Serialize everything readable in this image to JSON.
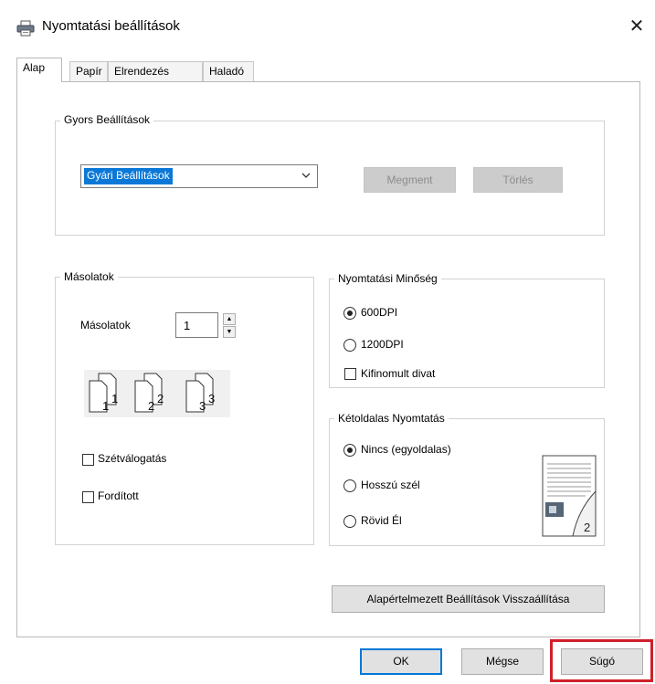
{
  "window": {
    "title": "Nyomtatási beállítások",
    "close_symbol": "✕"
  },
  "tabs": [
    {
      "label": "Alap",
      "active": true
    },
    {
      "label": "Papír",
      "active": false
    },
    {
      "label": "Elrendezés",
      "active": false
    },
    {
      "label": "Haladó",
      "active": false
    }
  ],
  "quick_settings": {
    "title": "Gyors Beállítások",
    "selected": "Gyári Beállítások",
    "save_label": "Megment",
    "delete_label": "Törlés"
  },
  "copies": {
    "group_title": "Másolatok",
    "label": "Másolatok",
    "value": "1",
    "collate_label": "Szétválogatás",
    "collate_checked": false,
    "reverse_label": "Fordított",
    "reverse_checked": false,
    "page_icon_numbers": [
      "1",
      "1",
      "2",
      "2",
      "3",
      "3"
    ]
  },
  "quality": {
    "group_title": "Nyomtatási Minőség",
    "options": [
      {
        "label": "600DPI",
        "selected": true
      },
      {
        "label": "1200DPI",
        "selected": false
      }
    ],
    "refined_label": "Kifinomult divat",
    "refined_checked": false
  },
  "duplex": {
    "group_title": "Kétoldalas Nyomtatás",
    "options": [
      {
        "label": "Nincs (egyoldalas)",
        "selected": true
      },
      {
        "label": "Hosszú szél",
        "selected": false
      },
      {
        "label": "Rövid Él",
        "selected": false
      }
    ],
    "preview_page_number": "2"
  },
  "restore_defaults_label": "Alapértelmezett Beállítások Visszaállítása",
  "footer": {
    "ok_label": "OK",
    "cancel_label": "Mégse",
    "help_label": "Súgó"
  },
  "colors": {
    "selection": "#0b78d7",
    "highlight_frame": "#d0202a",
    "default_button_border": "#0078d7"
  },
  "icons": [
    "printer-icon",
    "close-icon",
    "chevron-down-icon",
    "spin-up-icon",
    "spin-down-icon",
    "collate-pages-icon",
    "duplex-preview-icon"
  ]
}
